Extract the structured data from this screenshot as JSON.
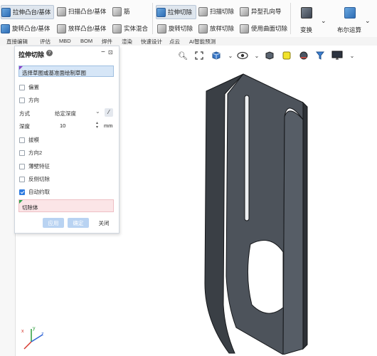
{
  "ribbon": {
    "row1": {
      "extrude_boss": "拉伸凸台/基体",
      "sweep_boss": "扫描凸台/基体",
      "rib": "筋",
      "extrude_cut": "拉伸切除",
      "sweep_cut": "扫描切除",
      "hole_wizard": "异型孔向导"
    },
    "row2": {
      "revolve_boss": "旋转凸台/基体",
      "loft_boss": "放样凸台/基体",
      "solid_mix": "实体混合",
      "revolve_cut": "旋转切除",
      "loft_cut": "放样切除",
      "surface_cut": "使用曲面切除"
    },
    "transform": "变换",
    "boolean": "布尔运算"
  },
  "tabs": [
    "直接编辑",
    "评估",
    "MBD",
    "BOM",
    "焊件",
    "渲染",
    "快速设计",
    "点云",
    "AI智能预测"
  ],
  "panel": {
    "title": "拉伸切除",
    "help_icon": "?",
    "sketch_hint": "选择草图或基准面绘制草图",
    "offset_label": "偏置",
    "direction_label": "方向",
    "mode_label": "方式",
    "mode_value": "给定深度",
    "depth_label": "深度",
    "depth_value": "10",
    "depth_unit": "mm",
    "draft_label": "拔模",
    "direction2_label": "方向2",
    "thin_feature_label": "薄壁特征",
    "flip_cut_label": "反侧切除",
    "auto_reduce_label": "自动约取",
    "auto_reduce_checked": true,
    "cut_body_label": "切除体",
    "apply_label": "应用",
    "ok_label": "确定",
    "close_label": "关闭"
  },
  "axis": {
    "x": "x",
    "y": "y",
    "z": "z"
  },
  "colors": {
    "accent": "#2d7be0",
    "sketch_field_bg": "#d6e6f7",
    "cut_body_field_bg": "#fbe5e7",
    "part_face": "#4a4f56",
    "part_edge": "#1a1c20"
  }
}
